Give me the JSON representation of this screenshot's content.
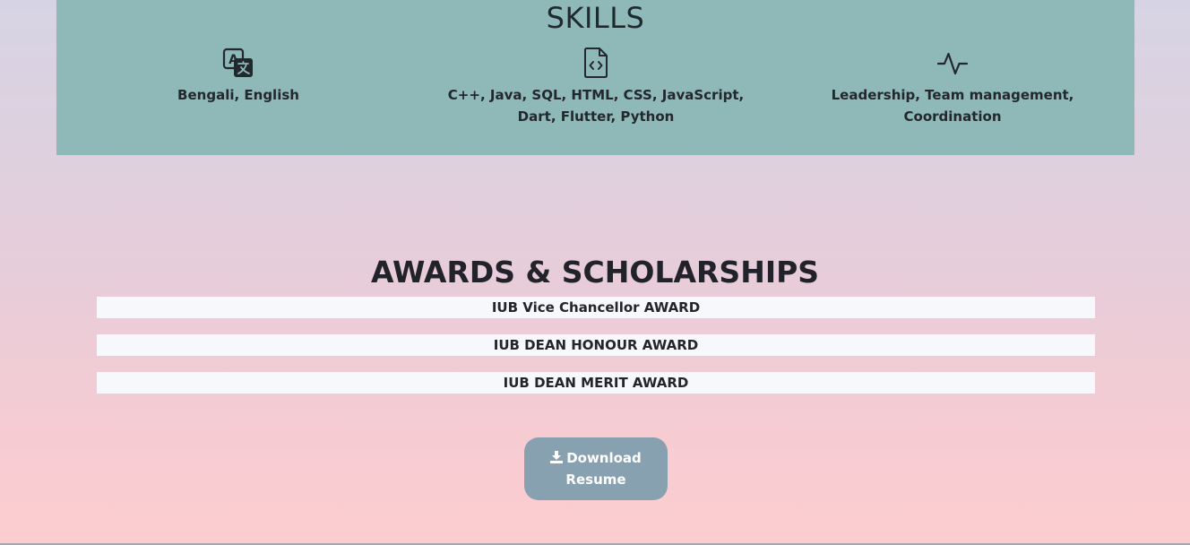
{
  "skills": {
    "title": "SKILLS",
    "items": [
      {
        "icon": "translate-icon",
        "text": "Bengali, English"
      },
      {
        "icon": "code-file-icon",
        "text": "C++, Java, SQL, HTML, CSS, JavaScript, Dart, Flutter, Python"
      },
      {
        "icon": "activity-icon",
        "text": "Leadership, Team management, Coordination"
      }
    ]
  },
  "awards": {
    "title": "AWARDS & SCHOLARSHIPS",
    "items": [
      "IUB Vice Chancellor AWARD",
      "IUB DEAN HONOUR AWARD",
      "IUB DEAN MERIT AWARD"
    ]
  },
  "download": {
    "label": "Download Resume",
    "icon": "download-icon"
  },
  "colors": {
    "skills_panel": "#8fb8b8",
    "award_row": "#f7f8fb",
    "button": "#88a1b0"
  }
}
